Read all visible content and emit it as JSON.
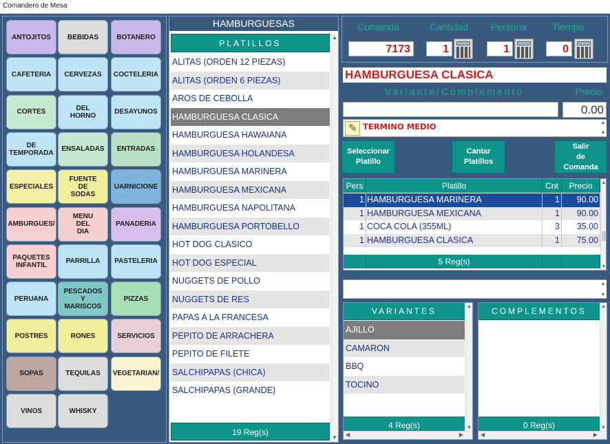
{
  "window": {
    "title": "Comandero de Mesa"
  },
  "categories": [
    {
      "label": "ANTOJITOS",
      "color": "#c9b8ea"
    },
    {
      "label": "BEBIDAS",
      "color": "#dcdcdc"
    },
    {
      "label": "BOTANERO",
      "color": "#c9b8ea"
    },
    {
      "label": "CAFETERIA",
      "color": "#bfe3f6"
    },
    {
      "label": "CERVEZAS",
      "color": "#bfe3f6"
    },
    {
      "label": "COCTELERIA",
      "color": "#bfe3f6"
    },
    {
      "label": "CORTES",
      "color": "#c5e8d2"
    },
    {
      "label": "DEL\nHORNO",
      "color": "#bfe3f6"
    },
    {
      "label": "DESAYUNOS",
      "color": "#bfe3f6"
    },
    {
      "label": "DE\nTEMPORADA",
      "color": "#bfe3f6"
    },
    {
      "label": "ENSALADAS",
      "color": "#c5e8d2"
    },
    {
      "label": "ENTRADAS",
      "color": "#b7e1c2"
    },
    {
      "label": "ESPECIALES",
      "color": "#f5f0a8"
    },
    {
      "label": "FUENTE\nDE\nSODAS",
      "color": "#f0f09a"
    },
    {
      "label": "UARNICIONE",
      "color": "#7fb4dd"
    },
    {
      "label": "AMBURGUES/",
      "color": "#f7cfd0"
    },
    {
      "label": "MENU\nDEL\nDIA",
      "color": "#f7cfd0"
    },
    {
      "label": "PANADERIA",
      "color": "#d9c0ec"
    },
    {
      "label": "PAQUETES\nINFANTIL",
      "color": "#f7cfd0"
    },
    {
      "label": "PARRILLA",
      "color": "#bfe3f6"
    },
    {
      "label": "PASTELERIA",
      "color": "#bfe3f6"
    },
    {
      "label": "PERUANA",
      "color": "#bfe3f6"
    },
    {
      "label": "PESCADOS\nY\nMARISCOS",
      "color": "#7fc8c6"
    },
    {
      "label": "PIZZAS",
      "color": "#a8e0b6"
    },
    {
      "label": "POSTRES",
      "color": "#f0f09a"
    },
    {
      "label": "RONES",
      "color": "#f0f09a"
    },
    {
      "label": "SERVICIOS",
      "color": "#e9d0d6"
    },
    {
      "label": "SOPAS",
      "color": "#bfa5a0"
    },
    {
      "label": "TEQUILAS",
      "color": "#dcdcdc"
    },
    {
      "label": "VEGETARIAN/",
      "color": "#fbf4d3"
    },
    {
      "label": "VINOS",
      "color": "#dcdcdc"
    },
    {
      "label": "WHISKY",
      "color": "#dcdcdc"
    }
  ],
  "dishes": {
    "title": "HAMBURGUESAS",
    "column_header": "PLATILLOS",
    "items": [
      "ALITAS (ORDEN 12 PIEZAS)",
      "ALITAS (ORDEN 6 PIEZAS)",
      "AROS DE CEBOLLA",
      "HAMBURGUESA CLASICA",
      "HAMBURGUESA HAWAIANA",
      "HAMBURGUESA HOLANDESA",
      "HAMBURGUESA MARINERA",
      "HAMBURGUESA MEXICANA",
      "HAMBURGUESA NAPOLITANA",
      "HAMBURGUESA PORTOBELLO",
      "HOT DOG CLASICO",
      "HOT DOG ESPECIAL",
      "NUGGETS DE POLLO",
      "NUGGETS DE RES",
      "PAPAS A LA FRANCESA",
      "PEPITO DE ARRACHERA",
      "PEPITO DE FILETE",
      "SALCHIPAPAS (CHICA)",
      "SALCHIPAPAS (GRANDE)"
    ],
    "selected_index": 3,
    "footer": "19 Reg(s)"
  },
  "order": {
    "labels": {
      "comanda": "Comanda",
      "cantidad": "Cantidad",
      "persona": "Persona",
      "tiempo": "Tiempo"
    },
    "values": {
      "comanda": "7173",
      "cantidad": "1",
      "persona": "1",
      "tiempo": "0"
    },
    "dish_name": "HAMBURGUESA CLASICA",
    "variant_label": "Variante/Complemento",
    "price_label": "Precio",
    "variant_value": "",
    "price_value": "0.00",
    "note_text": "TERMINO MEDIO",
    "buttons": {
      "select": "Seleccionar\nPlatillo",
      "sing": "Cantar\nPlatillos",
      "exit": "Salir\nde\nComanda"
    }
  },
  "grid": {
    "headers": {
      "pers": "Pers",
      "platillo": "Platillo",
      "cnt": "Cnt",
      "precio": "Precio"
    },
    "rows": [
      {
        "pers": "1",
        "platillo": "HAMBURGUESA MARINERA",
        "cnt": "1",
        "precio": "90.00"
      },
      {
        "pers": "1",
        "platillo": "HAMBURGUESA MEXICANA",
        "cnt": "1",
        "precio": "90.00"
      },
      {
        "pers": "1",
        "platillo": "COCA COLA (355ML)",
        "cnt": "3",
        "precio": "35.00"
      },
      {
        "pers": "1",
        "platillo": "HAMBURGUESA CLASICA",
        "cnt": "1",
        "precio": "75.00"
      }
    ],
    "selected_index": 0,
    "footer": "5 Reg(s)"
  },
  "variants": {
    "header": "VARIANTES",
    "items": [
      "AJILLO",
      "CAMARON",
      "BBQ",
      "TOCINO"
    ],
    "selected_index": 0,
    "footer": "4 Reg(s)"
  },
  "complements": {
    "header": "COMPLEMENTOS",
    "items": [],
    "footer": "0 Reg(s)"
  }
}
